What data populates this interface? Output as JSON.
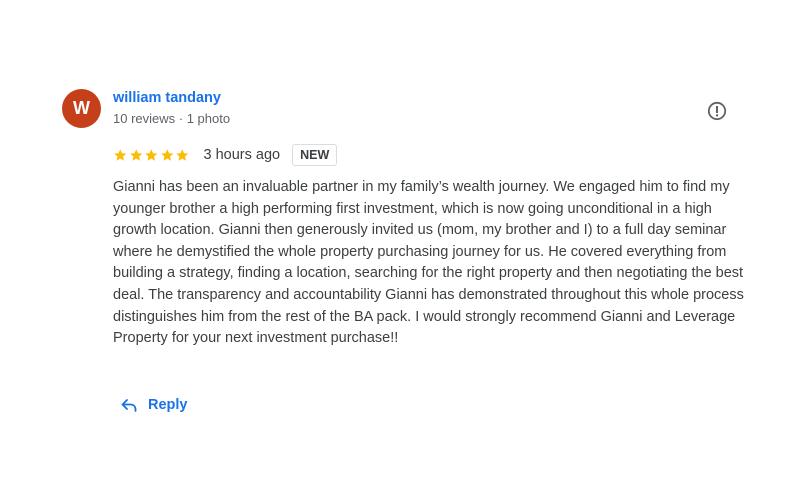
{
  "review": {
    "avatar_letter": "W",
    "avatar_color": "#c5401a",
    "reviewer_name": "william tandany",
    "reviewer_meta": "10 reviews · 1 photo",
    "report_icon": "report-flag-icon",
    "rating": 5,
    "rating_max": 5,
    "star_color": "#fbbc04",
    "time_ago": "3 hours ago",
    "badge": "NEW",
    "text": "Gianni has been an invaluable partner in my family’s wealth journey. We engaged him to find my younger brother a high performing first investment, which is now going unconditional in a high growth location. Gianni then generously invited us (mom, my brother and I) to a full day seminar where he demystified the whole property purchasing journey for us. He covered everything from building a strategy, finding a location, searching for the right property and then negotiating the best deal. The transparency and accountability Gianni has demonstrated throughout this whole process distinguishes him from the rest of the BA pack. I would strongly recommend Gianni and Leverage Property for your next investment purchase!!"
  },
  "actions": {
    "reply_label": "Reply",
    "reply_icon": "reply-arrow-icon",
    "accent_color": "#1a73e8"
  }
}
